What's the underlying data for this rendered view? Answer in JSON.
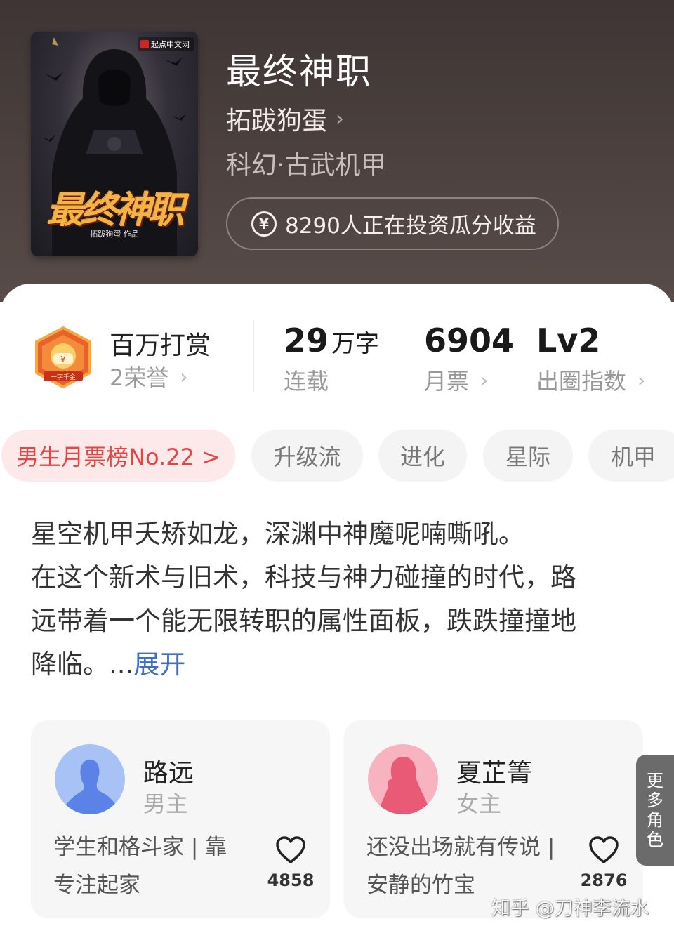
{
  "book": {
    "cover": {
      "brand": "起点中文网",
      "title": "最终神职",
      "author_line": "拓跋狗蛋 作品"
    },
    "title": "最终神职",
    "author": "拓跋狗蛋",
    "genre": "科幻·古武机甲",
    "investment_text": "8290人正在投资瓜分收益"
  },
  "stats": {
    "award": {
      "title": "百万打赏",
      "honors": "2荣誉",
      "badge_text": "一字千金"
    },
    "word_count": {
      "value": "29",
      "unit": "万字",
      "label": "连载"
    },
    "monthly_votes": {
      "value": "6904",
      "label": "月票"
    },
    "popularity": {
      "value": "Lv2",
      "label": "出圈指数"
    }
  },
  "tags": {
    "rank": "男生月票榜No.22 >",
    "items": [
      "升级流",
      "进化",
      "星际",
      "机甲"
    ]
  },
  "synopsis": {
    "lines": [
      "星空机甲夭矫如龙，深渊中神魔呢喃嘶吼。",
      "在这个新术与旧术，科技与神力碰撞的时代，路",
      "远带着一个能无限转职的属性面板，跌跌撞撞地",
      "降临。..."
    ],
    "expand_label": "展开"
  },
  "characters": [
    {
      "name": "路远",
      "role": "男主",
      "desc_lines": [
        "学生和格斗家 | 靠",
        "专注起家"
      ],
      "likes": "4858",
      "avatar_color": "#7fa3f0"
    },
    {
      "name": "夏芷箐",
      "role": "女主",
      "desc_lines": [
        "还没出场就有传说 |",
        "安静的竹宝"
      ],
      "likes": "2876",
      "avatar_color": "#f07f95"
    }
  ],
  "more_roles": [
    "更",
    "多",
    "角",
    "色"
  ],
  "watermark": "知乎 @刀神李流水",
  "colors": {
    "header_bg": "#4a3f3d",
    "rank_tag_bg": "#fde9e9",
    "rank_tag_text": "#e04848",
    "expand_link": "#3d6fc4"
  }
}
